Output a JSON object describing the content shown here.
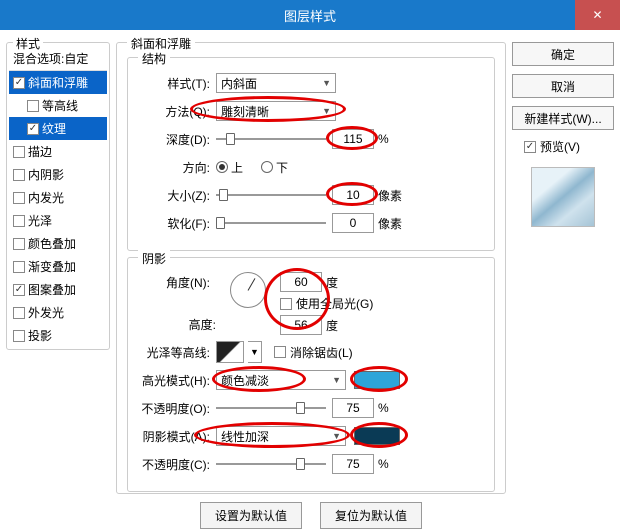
{
  "title": "图层样式",
  "close": "✕",
  "left": {
    "group_label": "样式",
    "blend_header": "混合选项:自定",
    "items": [
      {
        "label": "斜面和浮雕",
        "checked": true,
        "selected": true,
        "indent": false
      },
      {
        "label": "等高线",
        "checked": false,
        "selected": false,
        "indent": true
      },
      {
        "label": "纹理",
        "checked": true,
        "selected": true,
        "indent": true
      },
      {
        "label": "描边",
        "checked": false,
        "selected": false,
        "indent": false
      },
      {
        "label": "内阴影",
        "checked": false,
        "selected": false,
        "indent": false
      },
      {
        "label": "内发光",
        "checked": false,
        "selected": false,
        "indent": false
      },
      {
        "label": "光泽",
        "checked": false,
        "selected": false,
        "indent": false
      },
      {
        "label": "颜色叠加",
        "checked": false,
        "selected": false,
        "indent": false
      },
      {
        "label": "渐变叠加",
        "checked": false,
        "selected": false,
        "indent": false
      },
      {
        "label": "图案叠加",
        "checked": true,
        "selected": false,
        "indent": false
      },
      {
        "label": "外发光",
        "checked": false,
        "selected": false,
        "indent": false
      },
      {
        "label": "投影",
        "checked": false,
        "selected": false,
        "indent": false
      }
    ]
  },
  "mid": {
    "group_label": "斜面和浮雕",
    "struct_label": "结构",
    "style_lbl": "样式(T):",
    "style_val": "内斜面",
    "tech_lbl": "方法(Q):",
    "tech_val": "雕刻清晰",
    "depth_lbl": "深度(D):",
    "depth_val": "115",
    "pct": "%",
    "dir_lbl": "方向:",
    "dir_up": "上",
    "dir_down": "下",
    "size_lbl": "大小(Z):",
    "size_val": "10",
    "px": "像素",
    "soften_lbl": "软化(F):",
    "soften_val": "0",
    "shade_label": "阴影",
    "angle_lbl": "角度(N):",
    "angle_val": "60",
    "deg": "度",
    "global": "使用全局光(G)",
    "alt_lbl": "高度:",
    "alt_val": "56",
    "gloss_lbl": "光泽等高线:",
    "anti": "消除锯齿(L)",
    "hl_lbl": "高光模式(H):",
    "hl_val": "颜色减淡",
    "opac_lbl": "不透明度(O):",
    "opac1_val": "75",
    "sh_lbl": "阴影模式(A):",
    "sh_val": "线性加深",
    "opac2_lbl": "不透明度(C):",
    "opac2_val": "75",
    "btn_default": "设置为默认值",
    "btn_reset": "复位为默认值"
  },
  "right": {
    "ok": "确定",
    "cancel": "取消",
    "new_style": "新建样式(W)...",
    "preview_lbl": "预览(V)"
  }
}
